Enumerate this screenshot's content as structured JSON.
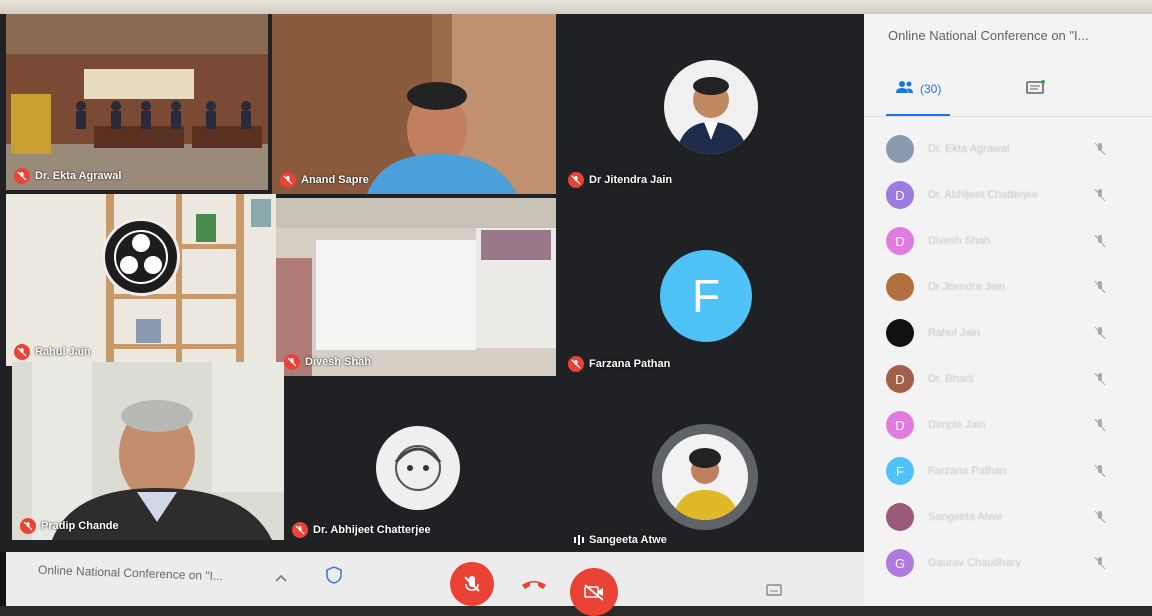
{
  "meeting": {
    "title": "Online National Conference on \"I...",
    "bottom_title": "Online National Conference on \"I..."
  },
  "tiles": [
    {
      "name": "Dr. Ekta Agrawal"
    },
    {
      "name": "Anand Sapre"
    },
    {
      "name": "Dr Jitendra Jain"
    },
    {
      "name": "Rahul Jain"
    },
    {
      "name": "Divesh Shah"
    },
    {
      "name": "Farzana Pathan",
      "letter": "F"
    },
    {
      "name": "Pradip Chande"
    },
    {
      "name": "Dr. Abhijeet Chatterjee"
    },
    {
      "name": "Sangeeta Atwe"
    }
  ],
  "panel": {
    "people_tab": "(30)",
    "participants": [
      {
        "initial": "",
        "color": "#8a9bb0",
        "name": "Dr. Ekta Agrawal"
      },
      {
        "initial": "D",
        "color": "#9c7be0",
        "name": "Dr. Abhijeet Chatterjee"
      },
      {
        "initial": "D",
        "color": "#e07be0",
        "name": "Divesh Shah"
      },
      {
        "initial": "",
        "color": "#b07040",
        "name": "Dr Jitendra Jain"
      },
      {
        "initial": "",
        "color": "#111111",
        "name": "Rahul Jain"
      },
      {
        "initial": "D",
        "color": "#a0604a",
        "name": "Dr. Bharti"
      },
      {
        "initial": "D",
        "color": "#e07be0",
        "name": "Dimple Jain"
      },
      {
        "initial": "F",
        "color": "#4fc3f7",
        "name": "Farzana Pathan"
      },
      {
        "initial": "",
        "color": "#9a5a7a",
        "name": "Sangeeta Atwe"
      },
      {
        "initial": "G",
        "color": "#b07be0",
        "name": "Gaurav Chaudhary"
      }
    ]
  },
  "colors": {
    "accent": "#1a73e8",
    "danger": "#ea4335",
    "avatar_blue": "#4fc3f7"
  }
}
